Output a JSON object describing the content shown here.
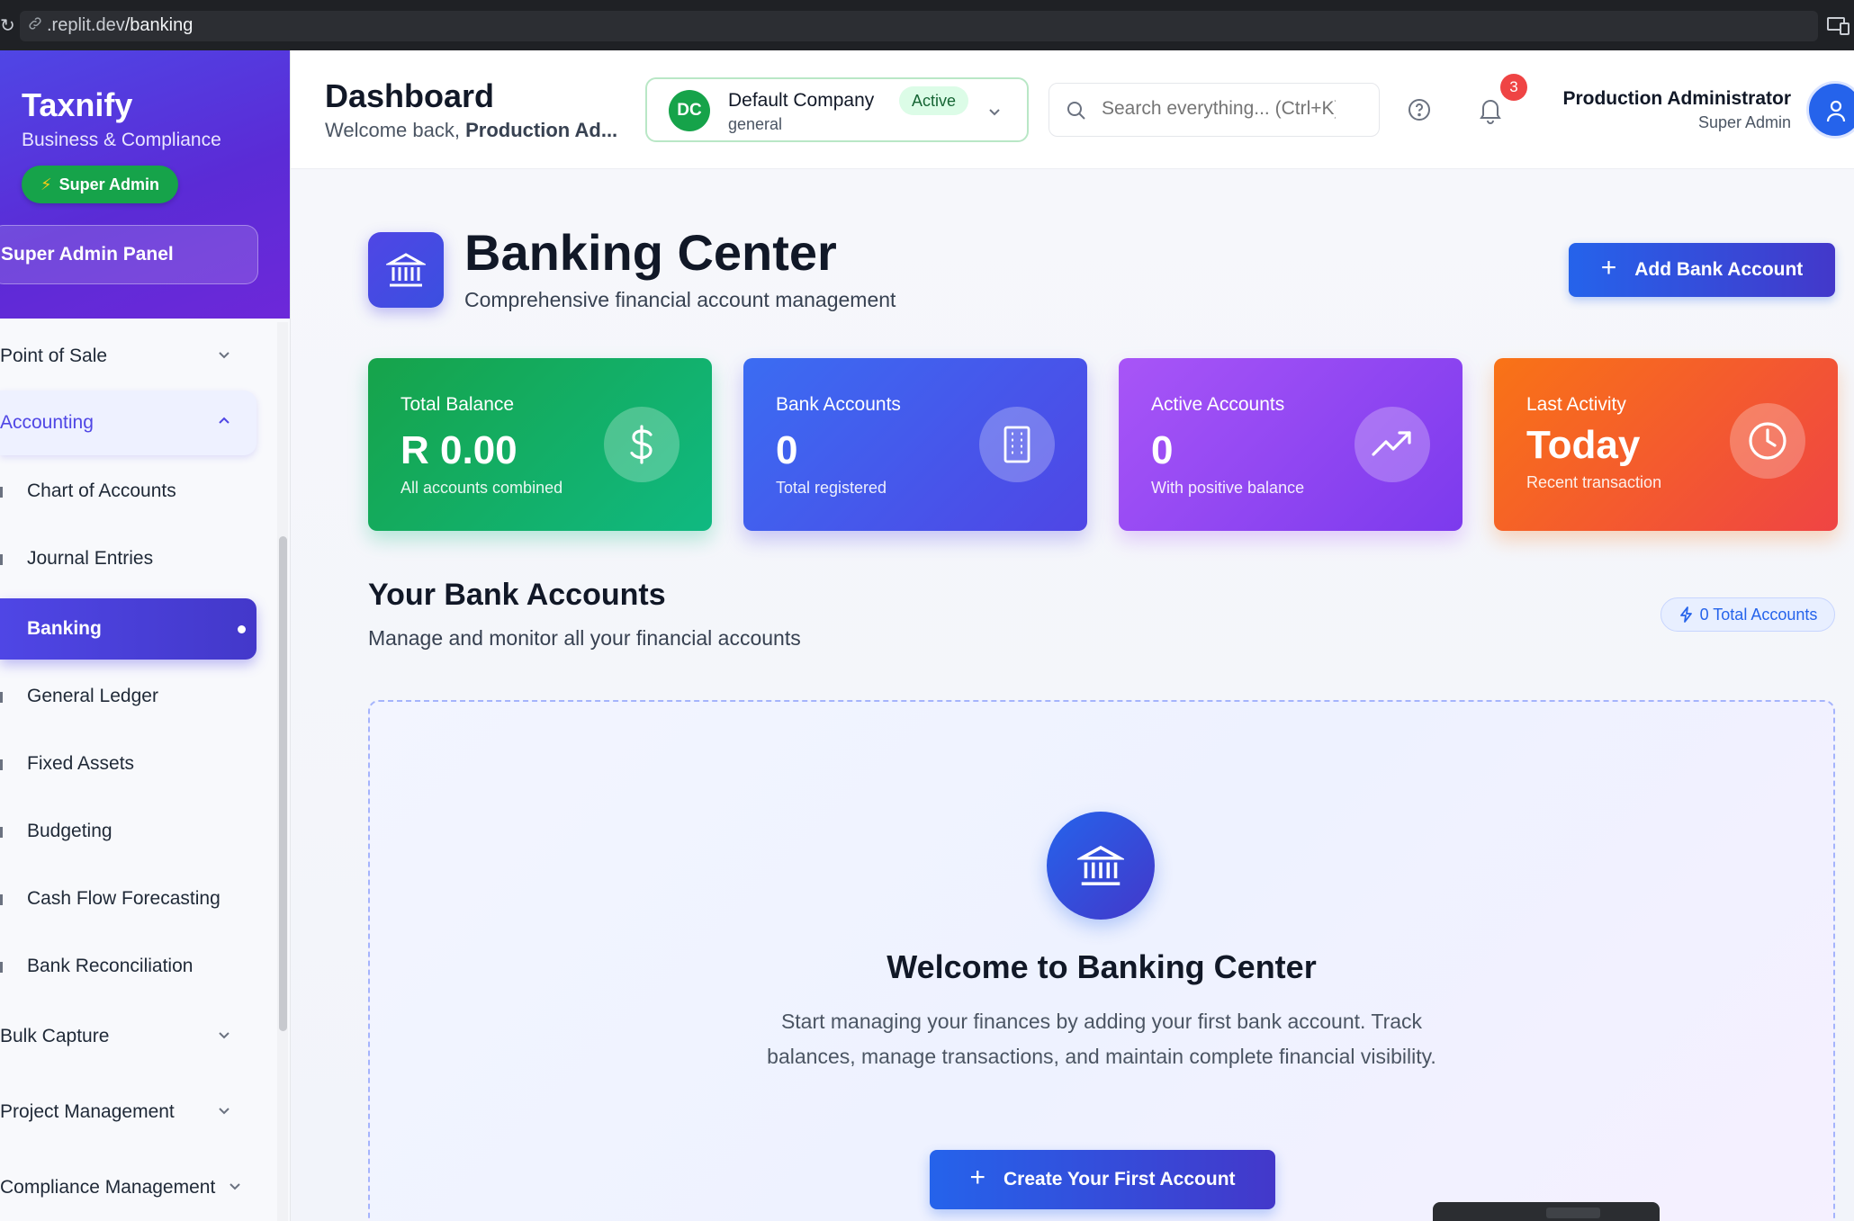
{
  "browser": {
    "url_host": ".replit.dev",
    "url_path": "/banking"
  },
  "sidebar": {
    "brand": "Taxnify",
    "brand_sub": "Business & Compliance",
    "role_badge": "Super Admin",
    "panel_button": "Super Admin Panel",
    "groups": [
      {
        "label": "Point of Sale"
      },
      {
        "label": "Accounting"
      },
      {
        "label": "Bulk Capture"
      },
      {
        "label": "Project Management"
      },
      {
        "label": "Compliance Management"
      }
    ],
    "items": [
      {
        "label": "Chart of Accounts"
      },
      {
        "label": "Journal Entries"
      },
      {
        "label": "Banking"
      },
      {
        "label": "General Ledger"
      },
      {
        "label": "Fixed Assets"
      },
      {
        "label": "Budgeting"
      },
      {
        "label": "Cash Flow Forecasting"
      },
      {
        "label": "Bank Reconciliation"
      }
    ]
  },
  "header": {
    "title": "Dashboard",
    "welcome_prefix": "Welcome back, ",
    "welcome_name": "Production Ad...",
    "company": {
      "initials": "DC",
      "name": "Default Company",
      "status": "Active",
      "sub": "general"
    },
    "search_placeholder": "Search everything... (Ctrl+K)",
    "notification_count": "3",
    "user": {
      "name": "Production Administrator",
      "role": "Super Admin"
    }
  },
  "main": {
    "title": "Banking Center",
    "subtitle": "Comprehensive financial account management",
    "add_button": "Add Bank Account",
    "stats": [
      {
        "label": "Total Balance",
        "value": "R 0.00",
        "note": "All accounts combined",
        "icon": "dollar-icon"
      },
      {
        "label": "Bank Accounts",
        "value": "0",
        "note": "Total registered",
        "icon": "building-icon"
      },
      {
        "label": "Active Accounts",
        "value": "0",
        "note": "With positive balance",
        "icon": "trending-up-icon"
      },
      {
        "label": "Last Activity",
        "value": "Today",
        "note": "Recent transaction",
        "icon": "clock-icon"
      }
    ],
    "section_title": "Your Bank Accounts",
    "section_sub": "Manage and monitor all your financial accounts",
    "count_pill": "0 Total Accounts",
    "empty": {
      "title": "Welcome to Banking Center",
      "text": "Start managing your finances by adding your first bank account. Track balances, manage transactions, and maintain complete financial visibility.",
      "button": "Create Your First Account"
    }
  },
  "colors": {
    "accent": "#4f46e5",
    "success": "#16a34a",
    "primary_button": "#2563eb",
    "danger": "#ef4444"
  }
}
